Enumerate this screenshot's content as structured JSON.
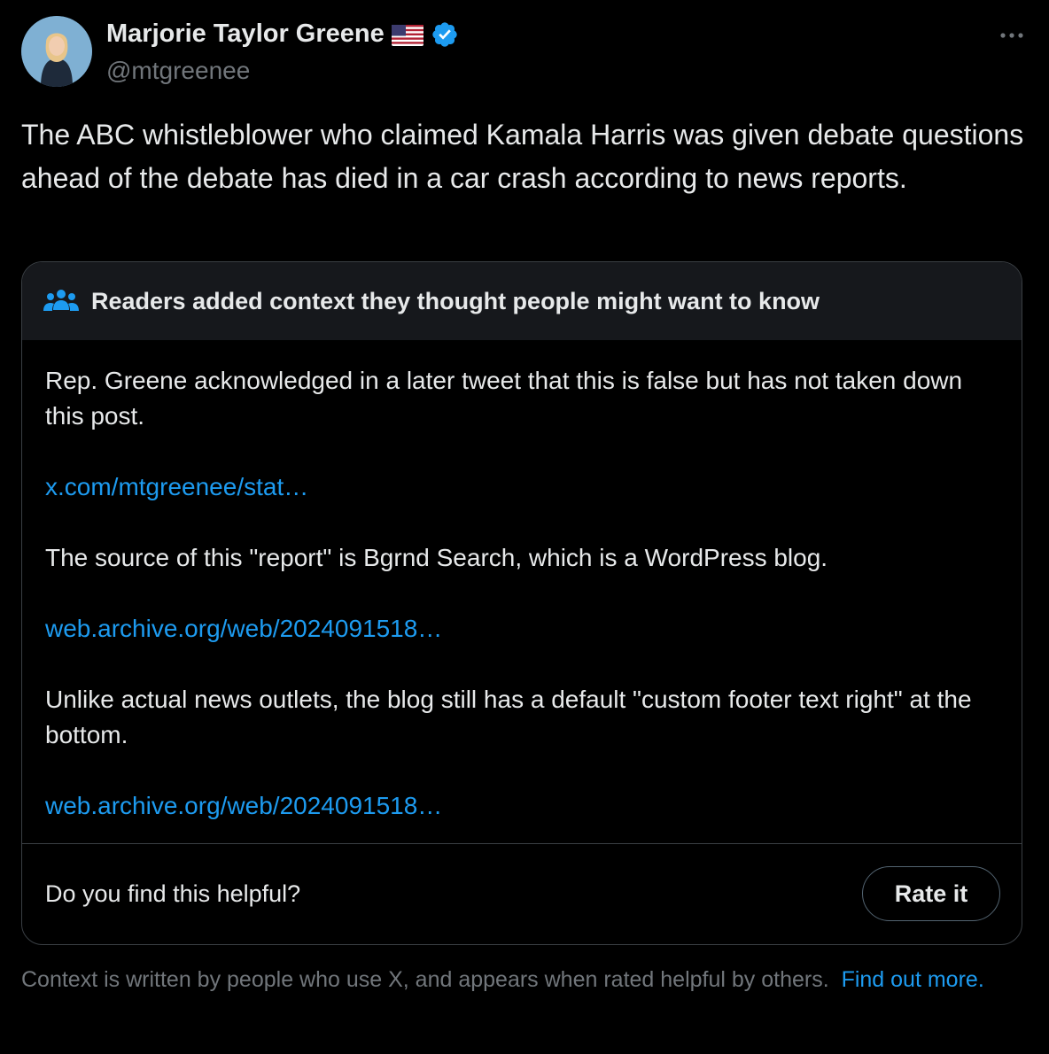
{
  "author": {
    "name": "Marjorie Taylor Greene",
    "handle": "@mtgreenee",
    "flag_icon": "us-flag-icon",
    "verified_icon": "verified-badge-icon",
    "verified_color": "#1d9bf0"
  },
  "tweet": {
    "text": "The ABC whistleblower who claimed Kamala Harris was given debate questions ahead of the debate has died in a car crash according to news reports."
  },
  "community_note": {
    "header_icon": "people-icon",
    "header": "Readers added context they thought people might want to know",
    "paragraph_1": "Rep. Greene acknowledged in a later tweet that this is false but has not taken down this post.",
    "link_1": "x.com/mtgreenee/stat…",
    "paragraph_2": "The source of this \"report\" is Bgrnd Search, which is a WordPress blog.",
    "link_2": "web.archive.org/web/2024091518…",
    "paragraph_3": "Unlike actual news outlets, the blog still has a default \"custom footer text right\" at the bottom.",
    "link_3": "web.archive.org/web/2024091518…",
    "helpful_question": "Do you find this helpful?",
    "rate_button": "Rate it"
  },
  "footer": {
    "text": "Context is written by people who use X, and appears when rated helpful by others.",
    "link": "Find out more."
  },
  "colors": {
    "background": "#000000",
    "text": "#e7e9ea",
    "muted": "#71767b",
    "link": "#1d9bf0",
    "note_header_bg": "#16181c",
    "border": "#3a3f44"
  }
}
